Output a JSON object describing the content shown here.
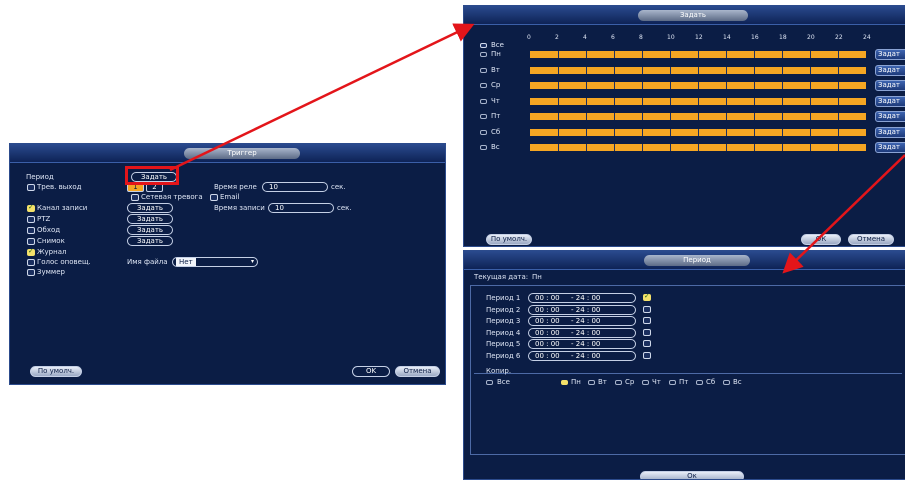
{
  "left_panel": {
    "title": "Триггер",
    "period_label": "Период",
    "zadat_label": "Задать",
    "trev_vyhod_label": "Трев. выход",
    "out1": "1",
    "out2": "2",
    "vremya_rele_label": "Время реле",
    "vremya_rele_value": "10",
    "sec_label": "сек.",
    "setevaya_trevoga_label": "Сетевая тревога",
    "email_label": "Email",
    "kanal_zapisi_label": "Канал записи",
    "vremya_zapisi_label": "Время записи",
    "vremya_zapisi_value": "10",
    "ptz_label": "PTZ",
    "obhod_label": "Обход",
    "snimok_label": "Снимок",
    "zhurnal_label": "Журнал",
    "golos_label": "Голос оповещ.",
    "imya_faila_label": "Имя файла",
    "imya_faila_value": "Нет",
    "zummer_label": "Зуммер",
    "default_button": "По умолч.",
    "ok_button": "OK",
    "cancel_button": "Отмена"
  },
  "schedule_panel": {
    "title": "Задать",
    "all_label": "Все",
    "hours": [
      "0",
      "2",
      "4",
      "6",
      "8",
      "10",
      "12",
      "14",
      "16",
      "18",
      "20",
      "22",
      "24"
    ],
    "days": [
      {
        "label": "Пн",
        "button": "Задат"
      },
      {
        "label": "Вт",
        "button": "Задат"
      },
      {
        "label": "Ср",
        "button": "Задат"
      },
      {
        "label": "Чт",
        "button": "Задат"
      },
      {
        "label": "Пт",
        "button": "Задат"
      },
      {
        "label": "Сб",
        "button": "Задат"
      },
      {
        "label": "Вс",
        "button": "Задат"
      }
    ],
    "default_button": "По умолч.",
    "ok_button": "ОК",
    "cancel_button": "Отмена"
  },
  "period_panel": {
    "title": "Период",
    "current_date_label": "Текущая дата:",
    "current_date_value": "Пн",
    "periods": [
      {
        "label": "Период 1",
        "start": "00 : 00",
        "end": "- 24 : 00",
        "enabled": true
      },
      {
        "label": "Период 2",
        "start": "00 : 00",
        "end": "- 24 : 00",
        "enabled": false
      },
      {
        "label": "Период 3",
        "start": "00 : 00",
        "end": "- 24 : 00",
        "enabled": false
      },
      {
        "label": "Период 4",
        "start": "00 : 00",
        "end": "- 24 : 00",
        "enabled": false
      },
      {
        "label": "Период 5",
        "start": "00 : 00",
        "end": "- 24 : 00",
        "enabled": false
      },
      {
        "label": "Период 6",
        "start": "00 : 00",
        "end": "- 24 : 00",
        "enabled": false
      }
    ],
    "copy_label": "Копир.",
    "copy_all_label": "Все",
    "copy_days": [
      "Пн",
      "Вт",
      "Ср",
      "Чт",
      "Пт",
      "Сб",
      "Вс"
    ],
    "ok_button": "Ок"
  },
  "colors": {
    "panel_bg": "#0b1d45",
    "schedule_bar": "#f5a623",
    "highlight_box": "#e3151a",
    "arrow": "#e3151a"
  }
}
